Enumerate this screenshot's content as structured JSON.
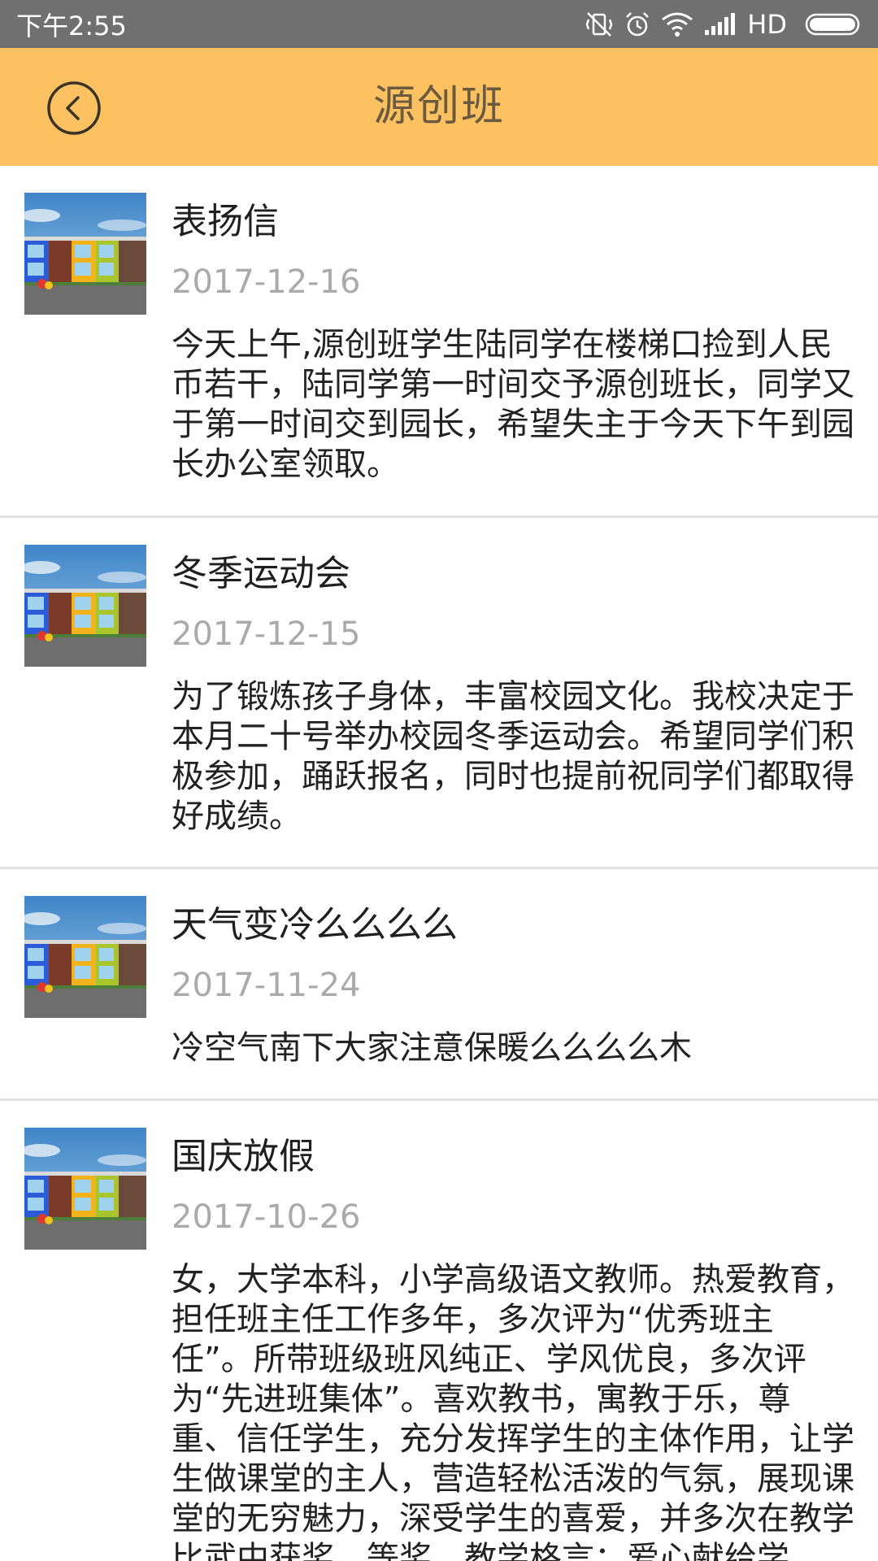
{
  "status": {
    "time": "下午2:55",
    "network": "HD"
  },
  "header": {
    "title": "源创班",
    "back_icon": "chevron-left-circle-icon",
    "background_color": "#fcc262"
  },
  "items": [
    {
      "title": "表扬信",
      "date": "2017-12-16",
      "desc": "今天上午,源创班学生陆同学在楼梯口捡到人民币若干，陆同学第一时间交予源创班长，同学又于第一时间交到园长，希望失主于今天下午到园长办公室领取。"
    },
    {
      "title": "冬季运动会",
      "date": "2017-12-15",
      "desc": "为了锻炼孩子身体，丰富校园文化。我校决定于本月二十号举办校园冬季运动会。希望同学们积极参加，踊跃报名，同时也提前祝同学们都取得好成绩。"
    },
    {
      "title": "天气变冷么么么么",
      "date": "2017-11-24",
      "desc": "冷空气南下大家注意保暖么么么么木"
    },
    {
      "title": "国庆放假",
      "date": "2017-10-26",
      "desc": "女，大学本科，小学高级语文教师。热爱教育，担任班主任工作多年，多次评为“优秀班主任”。所带班级班风纯正、学风优良，多次评为“先进班集体”。喜欢教书，寓教于乐，尊重、信任学生，充分发挥学生的主体作用，让学生做课堂的主人，营造轻松活泼的气氛，展现课堂的无穷魅力，深受学生的喜爱，并多次在教学比武中获奖。等奖，教学格言：爱心献给学"
    }
  ]
}
